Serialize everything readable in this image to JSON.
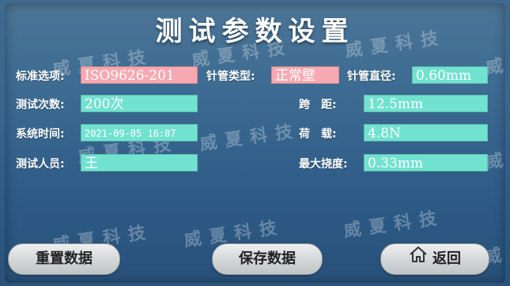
{
  "title": "测试参数设置",
  "watermark": "威夏科技",
  "watermark_char": "威",
  "fields": {
    "standard_label": "标准选项:",
    "standard_value": "ISO9626-201",
    "needle_type_label": "针管类型:",
    "needle_type_value": "正常壁",
    "needle_diameter_label": "针管直径:",
    "needle_diameter_value": "0.60mm",
    "test_count_label": "测试次数:",
    "test_count_value": "200次",
    "span_label": "跨　距:",
    "span_value": "12.5mm",
    "system_time_label": "系统时间:",
    "system_time_value": "2021-09-05 16:07",
    "load_label": "荷　载:",
    "load_value": "4.8N",
    "tester_label": "测试人员:",
    "tester_value": "王",
    "max_deflection_label": "最大挠度:",
    "max_deflection_value": "0.33mm"
  },
  "buttons": {
    "reset_label": "重置数据",
    "save_label": "保存数据",
    "back_label": "返回"
  },
  "icons": {
    "back_icon": "home-icon"
  },
  "colors": {
    "field_cyan": "#72e2d0",
    "field_pink": "#f7a8b0"
  }
}
